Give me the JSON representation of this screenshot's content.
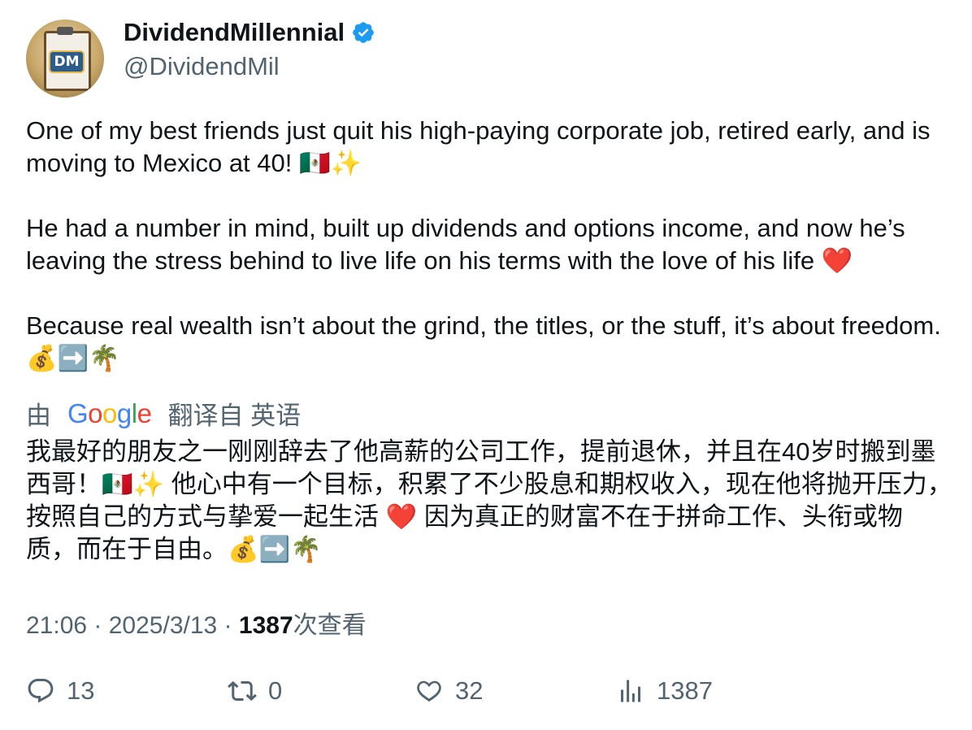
{
  "author": {
    "display_name": "DividendMillennial",
    "handle": "@DividendMil",
    "avatar_monogram": "DM",
    "verified_icon": "verified-badge-icon",
    "verified_color": "#1d9bf0"
  },
  "tweet": {
    "text": "One of my best friends just quit his high-paying corporate job, retired early, and is moving to Mexico at 40! 🇲🇽✨\n\nHe had a number in mind, built up dividends and options income, and now he’s leaving the stress behind to live life on his terms with the love of his life ❤️\n\nBecause real wealth isn’t about the grind, the titles, or the stuff, it’s about freedom. 💰➡️🌴"
  },
  "translation": {
    "by_label": "由",
    "provider_logo": "Google",
    "translated_from_label": "翻译自 英语",
    "text": "我最好的朋友之一刚刚辞去了他高薪的公司工作，提前退休，并且在40岁时搬到墨西哥！🇲🇽✨ 他心中有一个目标，积累了不少股息和期权收入，现在他将抛开压力，按照自己的方式与挚爱一起生活 ❤️ 因为真正的财富不在于拼命工作、头衔或物质，而在于自由。💰➡️🌴"
  },
  "meta": {
    "time": "21:06",
    "separator": " · ",
    "date": "2025/3/13",
    "views_count": "1387",
    "views_label": "次查看"
  },
  "actions": {
    "reply_count": "13",
    "retweet_count": "0",
    "like_count": "32",
    "views_count": "1387"
  },
  "colors": {
    "text_primary": "#0f1419",
    "text_secondary": "#536471",
    "accent": "#1d9bf0"
  }
}
